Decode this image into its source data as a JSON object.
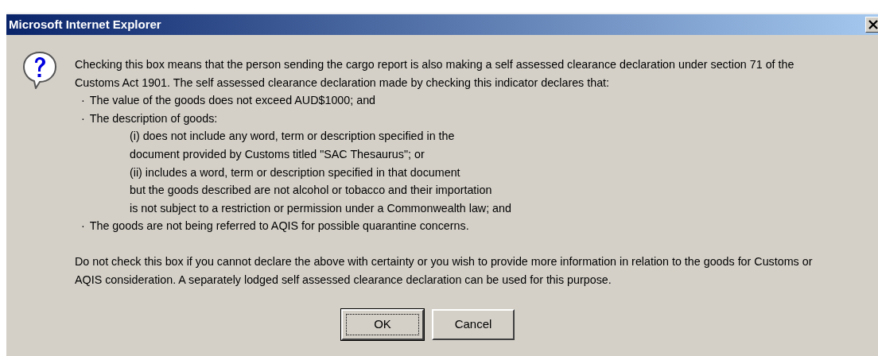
{
  "window": {
    "title": "Microsoft Internet Explorer"
  },
  "message": [
    {
      "kind": "plain",
      "text": "Checking this box means that the person sending the cargo report is also making a self assessed clearance declaration under section 71 of the"
    },
    {
      "kind": "plain",
      "text": "Customs Act 1901. The self assessed clearance declaration made by checking this indicator declares that:"
    },
    {
      "kind": "bullet",
      "bullet": "·",
      "text": "The value of the goods does not exceed AUD$1000; and"
    },
    {
      "kind": "bullet",
      "bullet": "·",
      "text": "The description of goods:"
    },
    {
      "kind": "indented",
      "text": "(i) does not include any word, term or description specified in the"
    },
    {
      "kind": "indented",
      "text": "document provided by Customs titled \"SAC Thesaurus\"; or"
    },
    {
      "kind": "indented",
      "text": "(ii) includes a word, term or description specified in that document"
    },
    {
      "kind": "indented",
      "text": "but the goods described are not alcohol or tobacco and their importation"
    },
    {
      "kind": "indented",
      "text": "is not subject to a restriction or permission under a Commonwealth law; and"
    },
    {
      "kind": "bullet",
      "bullet": "·",
      "text": "The goods are not being referred to AQIS for possible quarantine concerns."
    },
    {
      "kind": "gap"
    },
    {
      "kind": "plain",
      "text": "Do not check this box if you cannot declare the above with certainty or you wish to provide more information in relation to the goods for Customs or"
    },
    {
      "kind": "plain",
      "text": "AQIS consideration. A separately lodged self assessed clearance declaration can be used for this purpose."
    }
  ],
  "buttons": [
    {
      "label": "OK",
      "default": true
    },
    {
      "label": "Cancel",
      "default": false
    }
  ]
}
